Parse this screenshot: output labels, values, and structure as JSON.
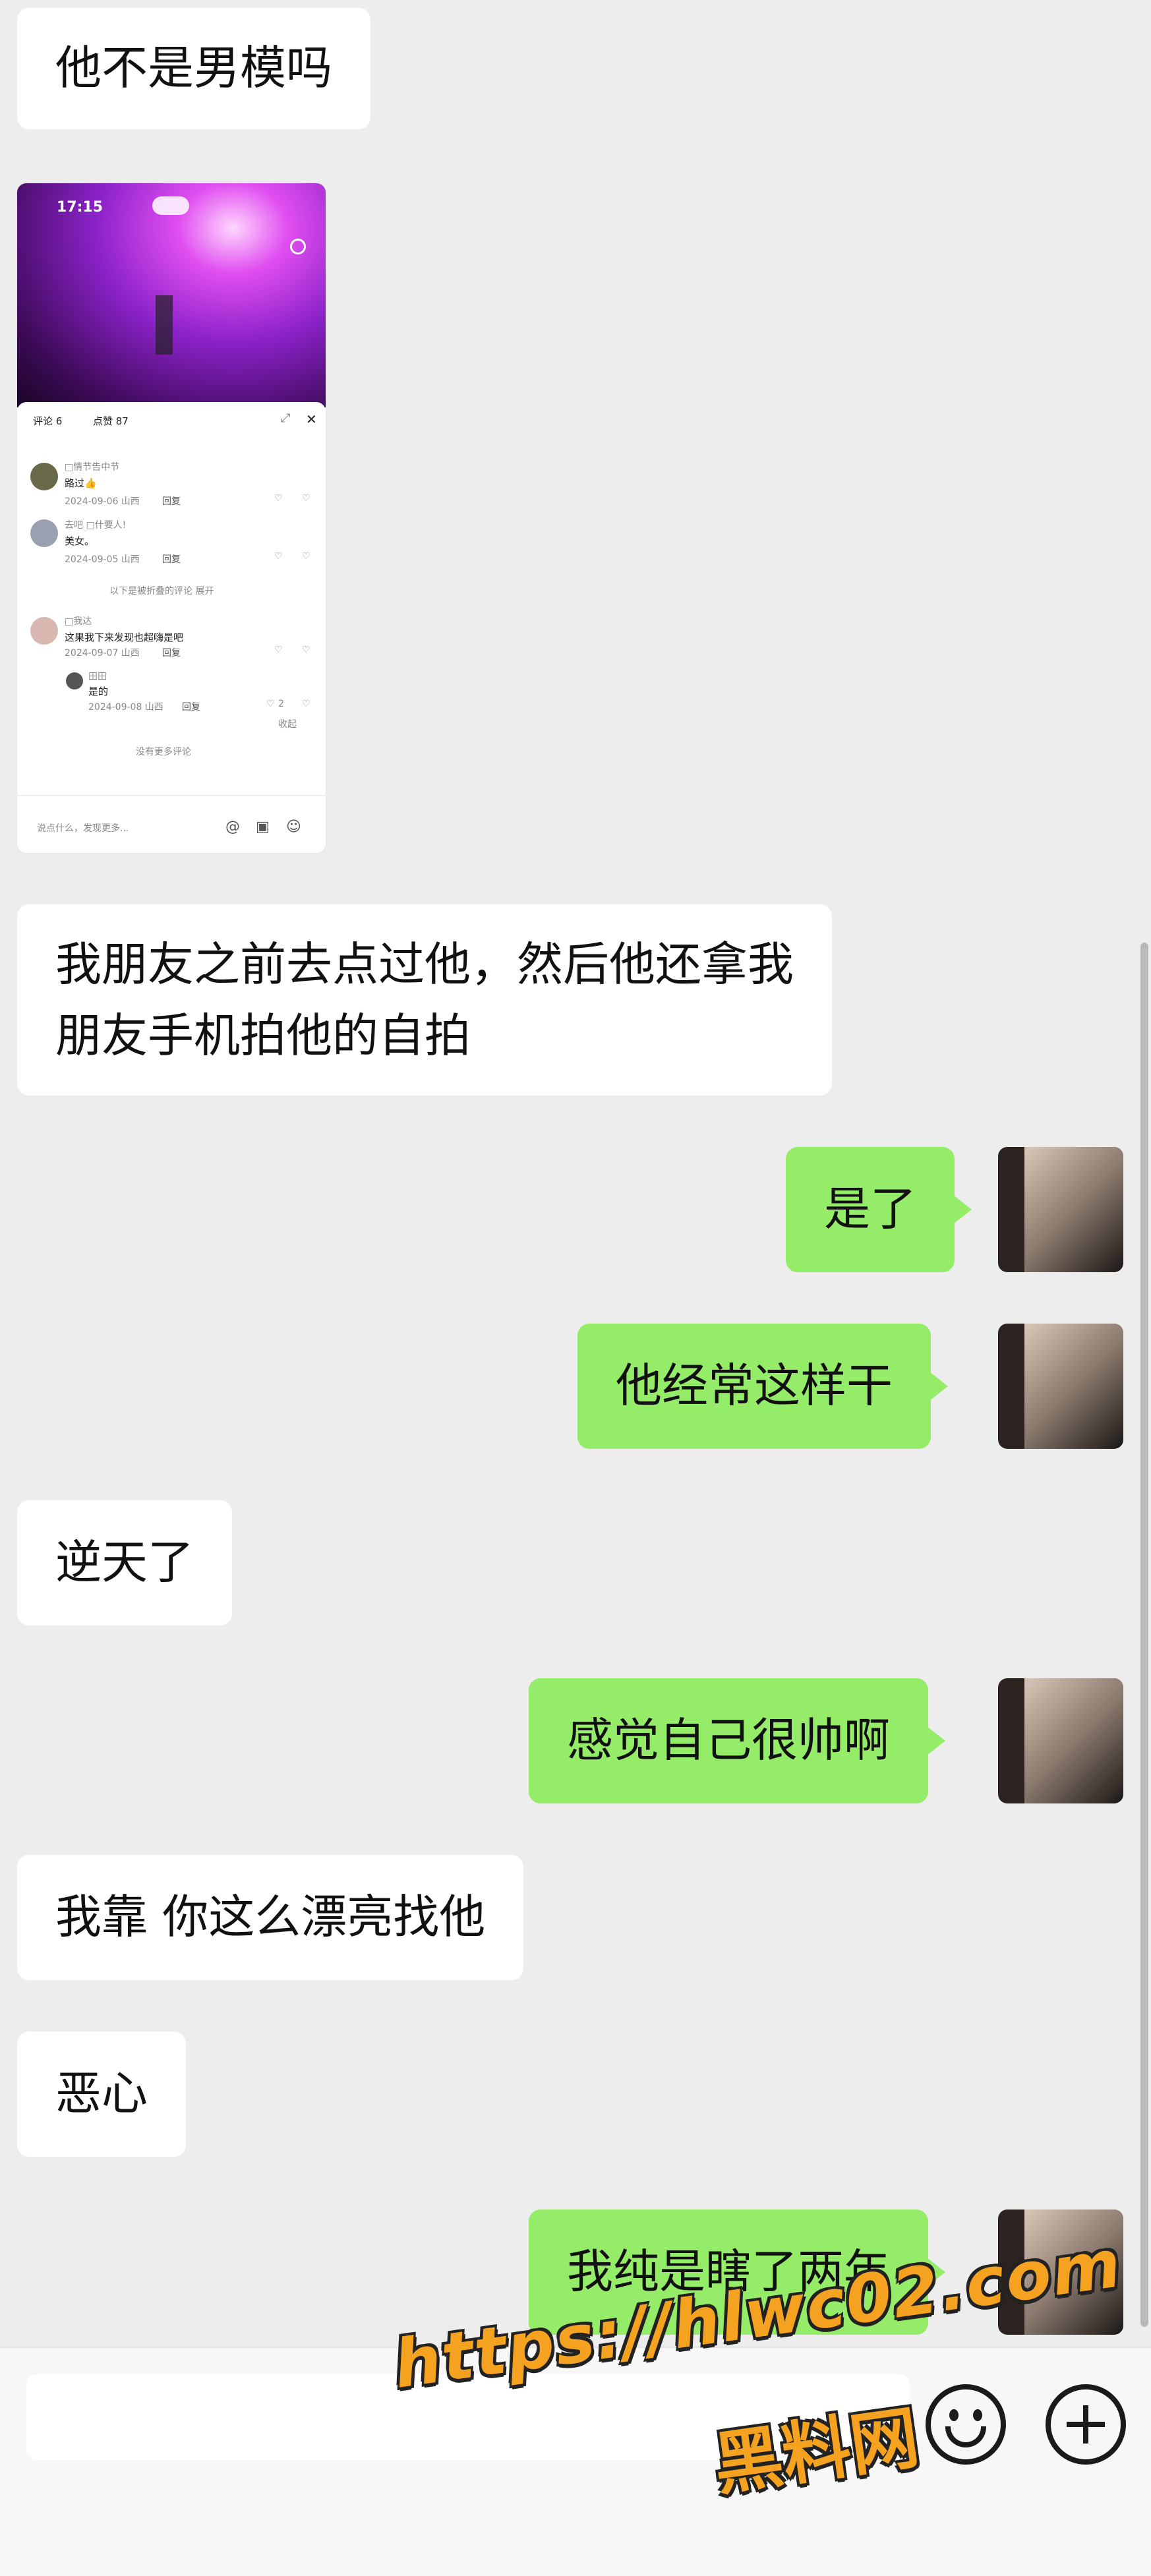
{
  "messages": [
    {
      "side": "recv",
      "text": "他不是男模吗"
    },
    {
      "side": "recv",
      "type": "image"
    },
    {
      "side": "recv",
      "lines": [
        "我朋友之前去点过他，然后他还拿我",
        "朋友手机拍他的自拍"
      ]
    },
    {
      "side": "sent",
      "text": "是了"
    },
    {
      "side": "sent",
      "text": "他经常这样干"
    },
    {
      "side": "recv",
      "text": "逆天了"
    },
    {
      "side": "sent",
      "text": "感觉自己很帅啊"
    },
    {
      "side": "recv",
      "text": "我靠 你这么漂亮找他"
    },
    {
      "side": "recv",
      "text": "恶心"
    },
    {
      "side": "sent",
      "text": "我纯是瞎了两年"
    }
  ],
  "screenshot": {
    "status_time": "17:15",
    "tab_label": "评论 6",
    "likes_label": "点赞 87",
    "comments": [
      {
        "name": "□情节告中节",
        "text": "路过👍",
        "date": "2024-09-06 山西"
      },
      {
        "name": "去吧 □什要人!",
        "text": "美女。",
        "date": "2024-09-05 山西"
      },
      {
        "collapsed": "以下是被折叠的评论 展开"
      },
      {
        "name": "□我达",
        "text": "这果我下来发现也超嗨是吧",
        "date": "2024-09-07 山西"
      },
      {
        "name": "田田",
        "text": "是的",
        "date": "2024-09-08 山西",
        "likes": "2"
      }
    ],
    "reply_label": "回复",
    "fold_label": "收起",
    "more_label": "没有更多评论",
    "input_placeholder": "说点什么，发现更多..."
  },
  "watermark": {
    "url": "https://hlwc02.com",
    "name": "黑料网"
  },
  "icons": {
    "emoji": "emoji-icon",
    "plus": "plus-icon"
  },
  "colors": {
    "sent_bubble": "#95ec69",
    "recv_bubble": "#ffffff",
    "background": "#ededed",
    "watermark": "#f4a21f"
  }
}
